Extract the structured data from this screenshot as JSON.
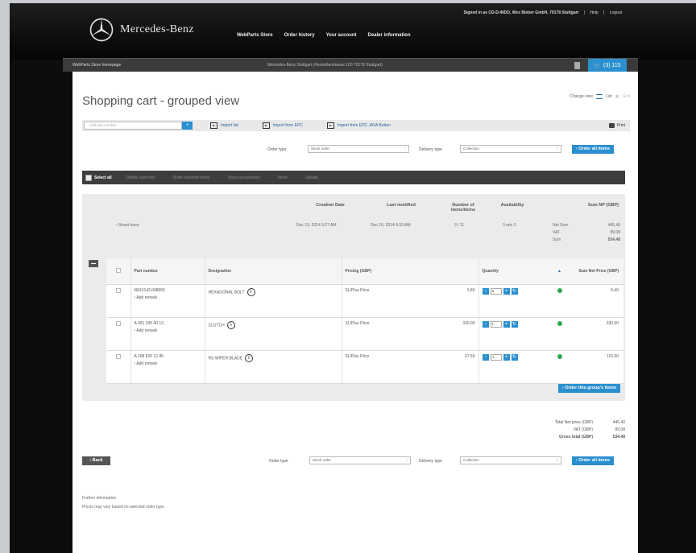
{
  "header": {
    "signed_in": "Signed in as CD-D-INDO, Wex Bieber GmbH, 70178 Stuttgart",
    "help": "Help",
    "logout": "Logout",
    "brand": "Mercedes-Benz",
    "nav": [
      "WebParts Store",
      "Order history",
      "Your account",
      "Dealer information"
    ]
  },
  "subbar": {
    "home": "WebParts Store homepage",
    "dealer": "Mercedes-Benz Stuttgart (Herstellerstrasse 100 70178 Stuttgart)",
    "cart": "(3) 115"
  },
  "page": {
    "title": "Shopping cart - grouped view",
    "change_view": "Change view",
    "view_list": "List",
    "view_grid": "Grid"
  },
  "toolbar": {
    "add_placeholder": "Add part number",
    "add_btn": "+",
    "import_list": "Import list",
    "import_epc": "Import from EPC",
    "import_epc_button": "Import from EPC JAVA Button",
    "print": "Print"
  },
  "order": {
    "order_type_label": "Order type",
    "order_type_value": "Stock order",
    "delivery_type_label": "Delivery type",
    "delivery_type_value": "Collection",
    "order_all": "› Order all items"
  },
  "actions": {
    "select_all": "Select all",
    "items": [
      "Delete selection",
      "Order selected items",
      "Show accessories",
      "Move",
      "Update"
    ]
  },
  "group": {
    "headers": {
      "creation": "Creation Date",
      "modified": "Last modified",
      "number": "Number of items/items",
      "availability": "Availability",
      "sum": "Sum NP (GBP)"
    },
    "name": "› Street boxe",
    "creation": "Dec 15, 2014 9:27 AM",
    "modified": "Dec 15, 2014 9:33 AM",
    "number": "3 / 11",
    "availability": "3 min 3",
    "sum_labels": [
      "Net Sum",
      "VAT",
      "Sum"
    ],
    "sum_values": [
      "445.40",
      "89.08",
      "534.48"
    ],
    "order_group": "› Order this group's items"
  },
  "table": {
    "columns": [
      "Part number",
      "Designation",
      "Pricing (GBP)",
      "Quantity",
      "Sum Net Price (GBP)"
    ],
    "rows": [
      {
        "part": "N910143 008006",
        "add": "› Add remark",
        "designation": "HEXAGONAL BOLT",
        "pricing": "SL/Plus Price",
        "price": "0.80",
        "qty": "8",
        "sum": "6.40"
      },
      {
        "part": "A 001 295 40 13",
        "add": "› Add remark",
        "designation": "CLUTCH",
        "pricing": "SL/Plus Price",
        "price": "330.00",
        "qty": "1",
        "sum": "330.00"
      },
      {
        "part": "A 168 820 12 45",
        "add": "› Add remark",
        "designation": "RS WIPER BLADE",
        "pricing": "SL/Plus Price",
        "price": "27.50",
        "qty": "4",
        "sum": "110.00"
      }
    ]
  },
  "totals": {
    "labels": [
      "Total Net price (GBP)",
      "VAT (GBP)",
      "Gross total (GBP)"
    ],
    "values": [
      "445.40",
      "89.08",
      "534.48"
    ]
  },
  "footer": {
    "back": "‹ Back",
    "further_title": "Further information",
    "further_text": "Prices may vary based on selected order type."
  }
}
